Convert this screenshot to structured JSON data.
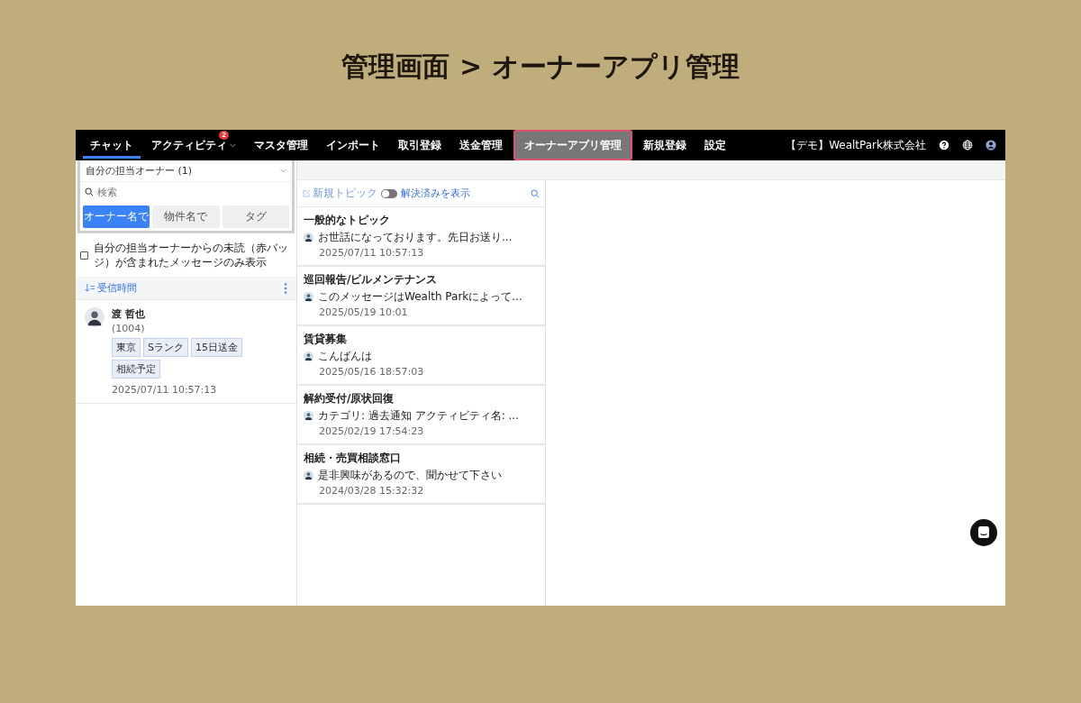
{
  "slide_title": "管理画面 > オーナーアプリ管理",
  "nav": {
    "items": [
      {
        "label": "チャット",
        "selected": true,
        "highlighted": false
      },
      {
        "label": "アクティビティ",
        "selected": false,
        "highlighted": false,
        "badge": "2",
        "dropdown": true
      },
      {
        "label": "マスタ管理",
        "selected": false,
        "highlighted": false
      },
      {
        "label": "インポート",
        "selected": false,
        "highlighted": false
      },
      {
        "label": "取引登録",
        "selected": false,
        "highlighted": false
      },
      {
        "label": "送金管理",
        "selected": false,
        "highlighted": false
      },
      {
        "label": "オーナーアプリ管理",
        "selected": false,
        "highlighted": true
      },
      {
        "label": "新規登録",
        "selected": false,
        "highlighted": false
      },
      {
        "label": "設定",
        "selected": false,
        "highlighted": false
      }
    ],
    "company": "【デモ】WealtPark株式会社"
  },
  "sidebar": {
    "filter": "自分の担当オーナー (1)",
    "search": {
      "placeholder": "検索"
    },
    "segments": [
      {
        "label": "オーナー名で",
        "selected": true
      },
      {
        "label": "物件名で",
        "selected": false
      },
      {
        "label": "タグ",
        "selected": false
      }
    ],
    "unread_only": {
      "label": "自分の担当オーナーからの未読（赤バッジ）が含まれたメッセージのみ表示",
      "checked": false
    },
    "sort": "受信時間",
    "owners": [
      {
        "name": "渡 哲也",
        "code": "(1004)",
        "tags": [
          "東京",
          "Sランク",
          "15日送金",
          "相続予定"
        ],
        "time": "2025/07/11 10:57:13"
      }
    ]
  },
  "topics": {
    "new_topic": "新規トピック",
    "show_resolved": {
      "label": "解決済みを表示",
      "on": false
    },
    "items": [
      {
        "title": "一般的なトピック",
        "message": "お世話になっております。先日お送り...",
        "time": "2025/07/11 10:57:13"
      },
      {
        "title": "巡回報告/ビルメンテナンス",
        "message": "このメッセージはWealth Parkによって...",
        "time": "2025/05/19 10:01"
      },
      {
        "title": "賃貸募集",
        "message": "こんばんは",
        "time": "2025/05/16 18:57:03"
      },
      {
        "title": "解約受付/原状回復",
        "message": "カテゴリ: 過去通知 アクティビティ名: ...",
        "time": "2025/02/19 17:54:23"
      },
      {
        "title": "相続・売買相談窓口",
        "message": "是非興味があるので、聞かせて下さい",
        "time": "2024/03/28 15:32:32"
      }
    ]
  }
}
